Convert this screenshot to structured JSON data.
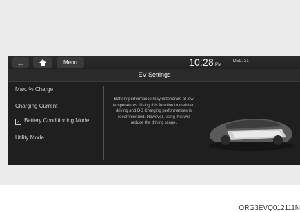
{
  "topbar": {
    "back_icon": "left-arrow-icon",
    "home_icon": "home-icon",
    "menu_label": "Menu",
    "time": "10:28",
    "ampm": "PM",
    "date": "DEC. 31"
  },
  "header": {
    "title": "EV Settings"
  },
  "sidebar": {
    "items": [
      {
        "label": "Max. % Charge"
      },
      {
        "label": "Charging Current"
      },
      {
        "label": "Battery Conditioning Mode",
        "checked": true
      },
      {
        "label": "Utility Mode"
      }
    ]
  },
  "main": {
    "description": "Battery performance may deteriorate at low temperatures. Using this function to maintain driving and DC Charging performances is recommended. However, using this will reduce the driving range."
  },
  "caption": "ORG3EVQ012111N"
}
